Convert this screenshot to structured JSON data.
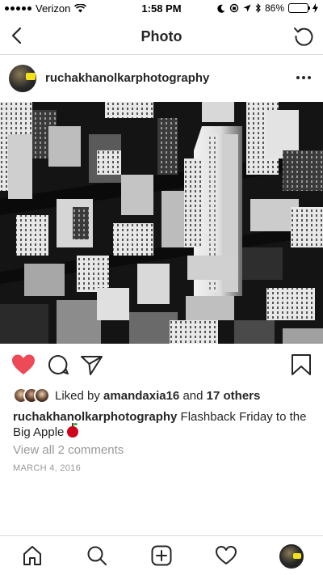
{
  "status_bar": {
    "carrier": "Verizon",
    "time": "1:58 PM",
    "battery_percent": "86%",
    "battery_level": 0.86
  },
  "nav": {
    "title": "Photo",
    "back_icon": "chevron-left-icon",
    "refresh_icon": "refresh-icon"
  },
  "post": {
    "username": "ruchakhanolkarphotography",
    "photo_description_icon": "city-photo",
    "liked": true,
    "likes": {
      "prefix": "Liked by",
      "user": "amandaxia16",
      "conjunction": "and",
      "others": "17 others"
    },
    "caption": {
      "username": "ruchakhanolkarphotography",
      "text": "Flashback Friday to the Big Apple"
    },
    "view_comments": "View all 2 comments",
    "date": "MARCH 4, 2016"
  },
  "colors": {
    "heart": "#ed4956",
    "text": "#262626",
    "muted": "#999999",
    "divider": "#dbdbdb"
  }
}
